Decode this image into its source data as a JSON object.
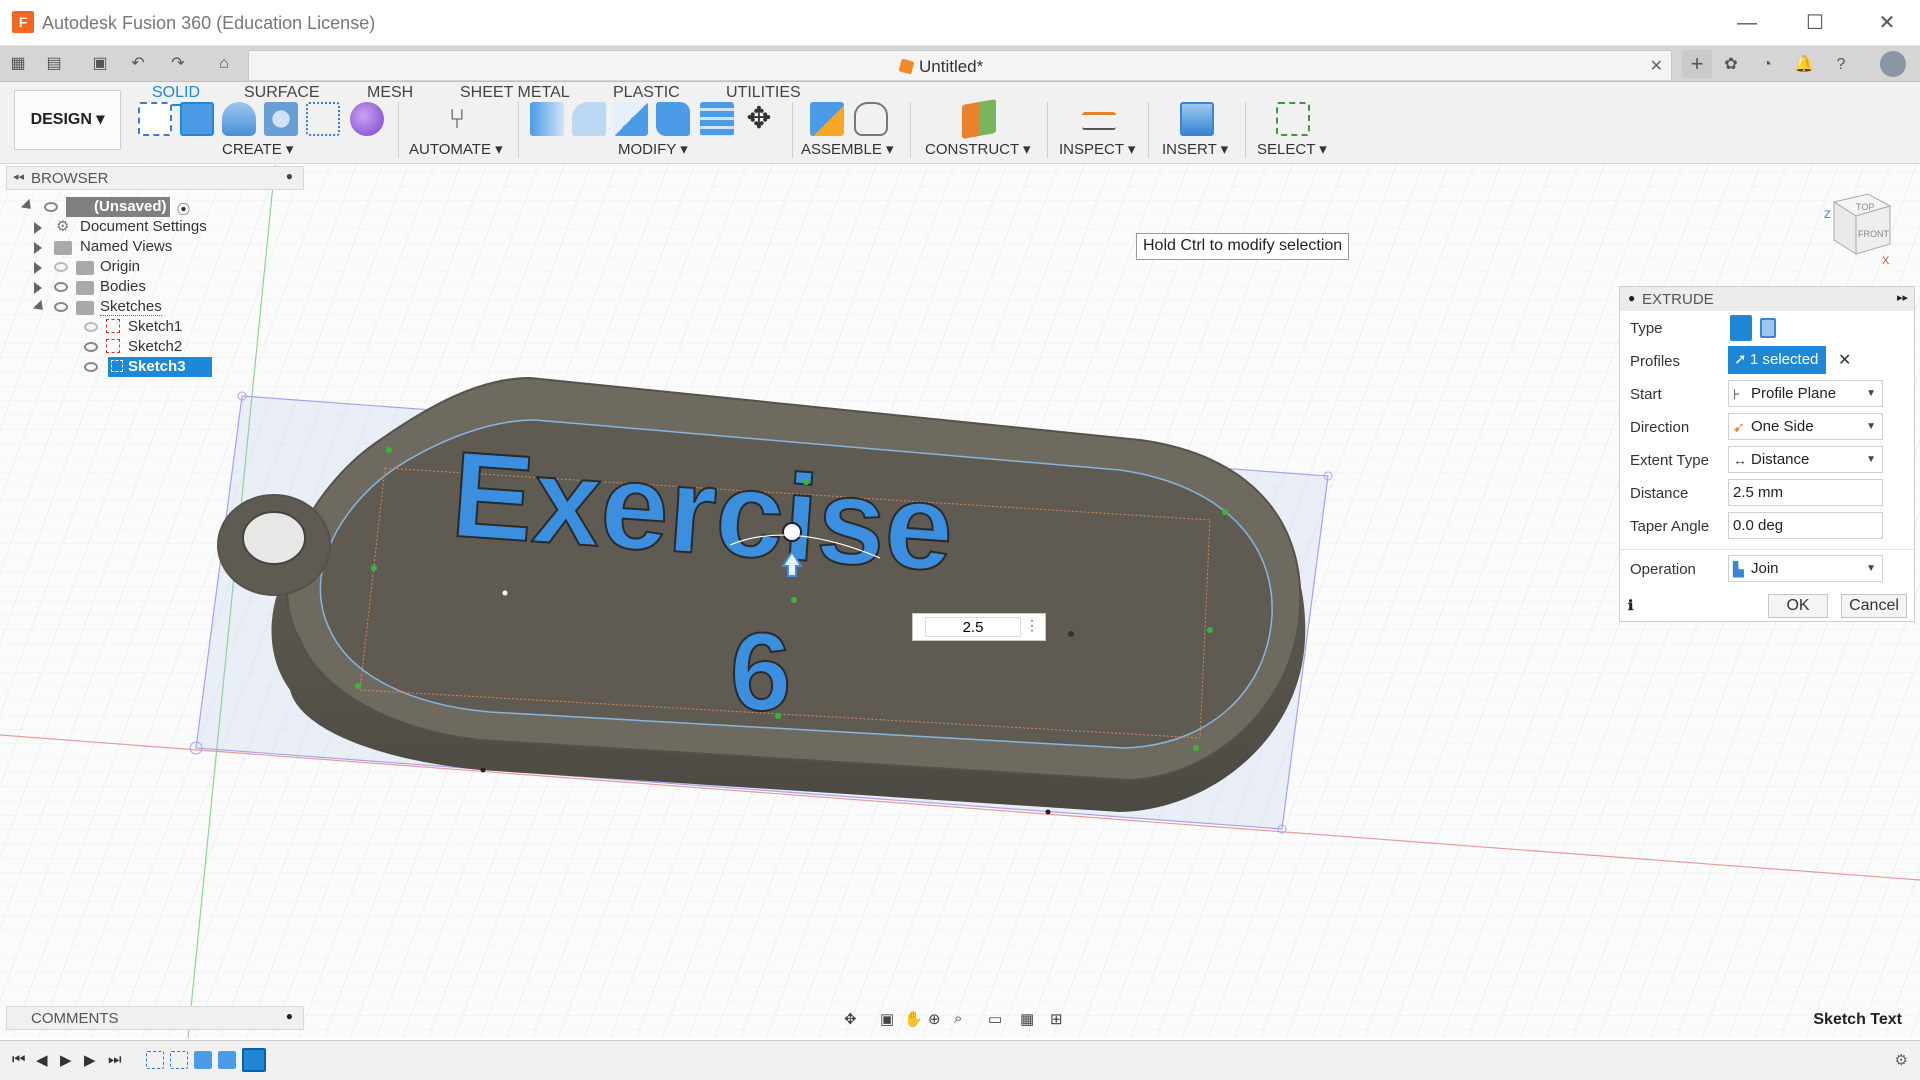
{
  "window": {
    "app_icon_letter": "F",
    "title": "Autodesk Fusion 360 (Education License)",
    "minimize_glyph": "—",
    "maximize_glyph": "☐",
    "close_glyph": "✕"
  },
  "document_tab": {
    "title": "Untitled*",
    "close_glyph": "✕",
    "new_tab_glyph": "+"
  },
  "workspace": {
    "design_label": "DESIGN ▾"
  },
  "toolbar": {
    "tabs": [
      "SOLID",
      "SURFACE",
      "MESH",
      "SHEET METAL",
      "PLASTIC",
      "UTILITIES"
    ],
    "active_tab": "SOLID",
    "groups": {
      "create": "CREATE ▾",
      "automate": "AUTOMATE ▾",
      "modify": "MODIFY ▾",
      "assemble": "ASSEMBLE ▾",
      "construct": "CONSTRUCT ▾",
      "inspect": "INSPECT ▾",
      "insert": "INSERT ▾",
      "select": "SELECT ▾"
    }
  },
  "browser": {
    "title": "BROWSER",
    "root": "(Unsaved)",
    "items": [
      {
        "label": "Document Settings"
      },
      {
        "label": "Named Views"
      },
      {
        "label": "Origin"
      },
      {
        "label": "Bodies"
      },
      {
        "label": "Sketches"
      }
    ],
    "sketches": [
      "Sketch1",
      "Sketch2",
      "Sketch3"
    ],
    "selected_sketch": "Sketch3"
  },
  "tooltip": {
    "text": "Hold Ctrl to modify selection"
  },
  "viewcube": {
    "top": "TOP",
    "front": "FRONT",
    "axis_x": "X",
    "axis_z": "Z"
  },
  "extrude": {
    "title": "EXTRUDE",
    "rows": {
      "type": "Type",
      "profiles": "Profiles",
      "start": "Start",
      "direction": "Direction",
      "extent_type": "Extent Type",
      "distance": "Distance",
      "taper_angle": "Taper Angle",
      "operation": "Operation"
    },
    "values": {
      "profiles": "1 selected",
      "start": "Profile Plane",
      "direction": "One Side",
      "extent_type": "Distance",
      "distance": "2.5 mm",
      "taper_angle": "0.0 deg",
      "operation": "Join"
    },
    "ok": "OK",
    "cancel": "Cancel"
  },
  "model": {
    "text_line1": "Exercise",
    "text_line2": "6",
    "dimension_value": "2.5"
  },
  "comments": {
    "title": "COMMENTS"
  },
  "status": {
    "text": "Sketch Text"
  },
  "colors": {
    "accent": "#1e88d6",
    "body_grey": "#5f5b52",
    "text_blue": "#3b8fde"
  }
}
